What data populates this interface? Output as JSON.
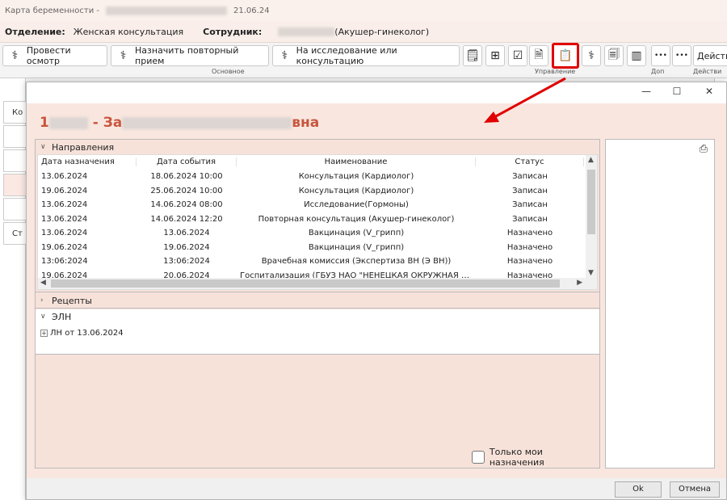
{
  "titlebar": {
    "prefix": "Карта беременности -",
    "date": "21.06.24"
  },
  "dept": {
    "dept_label": "Отделение:",
    "dept_value": "Женская консультация",
    "emp_label": "Сотрудник:",
    "emp_role": "(Акушер-гинеколог)"
  },
  "ribbon": {
    "btn_exam": "Провести осмотр",
    "btn_repeat": "Назначить повторный прием",
    "btn_research": "На исследование или консультацию",
    "more1": "•••",
    "more2": "•••",
    "actions": "Действ",
    "group_main": "Основное",
    "group_manage": "Управление",
    "group_extra": "Доп",
    "group_actions": "Действи"
  },
  "background": {
    "tab_ko": "Ко",
    "tab_st": "Ст"
  },
  "dialog": {
    "patient_name_start": "1",
    "patient_name_mid": " - За",
    "patient_name_end": "вна",
    "sections": {
      "directions": "Направления",
      "recipes": "Рецепты",
      "eln": "ЭЛН"
    },
    "columns": [
      "Дата назначения",
      "Дата события",
      "Наименование",
      "Статус"
    ],
    "rows": [
      [
        "13.06.2024",
        "18.06.2024 10:00",
        "Консультация (Кардиолог)",
        "Записан"
      ],
      [
        "19.06.2024",
        "25.06.2024 10:00",
        "Консультация (Кардиолог)",
        "Записан"
      ],
      [
        "13.06.2024",
        "14.06.2024 08:00",
        "Исследование(Гормоны)",
        "Записан"
      ],
      [
        "13.06.2024",
        "14.06.2024 12:20",
        "Повторная консультация (Акушер-гинеколог)",
        "Записан"
      ],
      [
        "13.06.2024",
        "13.06.2024",
        "Вакцинация (V_грипп)",
        "Назначено"
      ],
      [
        "19.06.2024",
        "19.06.2024",
        "Вакцинация (V_грипп)",
        "Назначено"
      ],
      [
        "13:06:2024",
        "13:06:2024",
        "Врачебная комиссия (Экспертиза ВН (Э ВН))",
        "Назначено"
      ],
      [
        "19.06.2024",
        "20.06.2024",
        "Госпитализация (ГБУЗ НАО \"НЕНЕЦКАЯ ОКРУЖНАЯ БО...",
        "Назначено"
      ]
    ],
    "eln_item": "ЛН от 13.06.2024",
    "only_mine": "Только мои назначения",
    "ok": "Ok",
    "cancel": "Отмена"
  },
  "colors": {
    "accent_red": "#e00000",
    "name_color": "#c8553d",
    "panel_bg": "#f9e6df"
  }
}
